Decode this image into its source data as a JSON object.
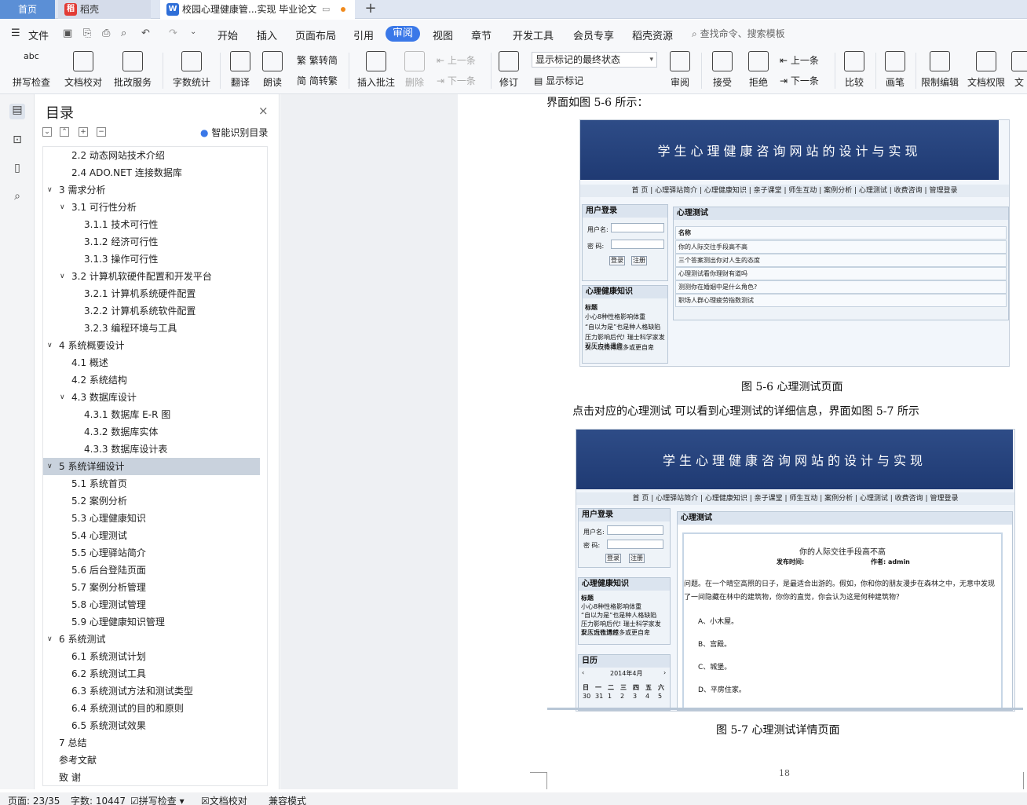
{
  "tabs": {
    "home": "首页",
    "daoke": "稻壳",
    "doc": "校园心理健康管...实现 毕业论文"
  },
  "menu": {
    "file": "文件",
    "items": [
      "开始",
      "插入",
      "页面布局",
      "引用",
      "审阅",
      "视图",
      "章节",
      "开发工具",
      "会员专享",
      "稻壳资源"
    ],
    "active": "审阅",
    "search": "查找命令、搜索模板"
  },
  "ribbon": {
    "spellcheck": "拼写检查",
    "doccheck": "文档校对",
    "batch": "批改服务",
    "wordcount": "字数统计",
    "translate": "翻译",
    "read": "朗读",
    "trad": "繁转简",
    "simp": "简转繁",
    "insertcomment": "插入批注",
    "delete": "删除",
    "prev": "上一条",
    "next": "下一条",
    "revise": "修订",
    "showstate": "显示标记的最终状态",
    "showmark": "显示标记",
    "review": "审阅",
    "accept": "接受",
    "reject": "拒绝",
    "prev2": "上一条",
    "next2": "下一条",
    "compare": "比较",
    "pen": "画笔",
    "restrict": "限制编辑",
    "perm": "文档权限",
    "more": "文"
  },
  "toc": {
    "title": "目录",
    "smart": "智能识别目录",
    "items": [
      "2.2  动态网站技术介绍",
      "2.4 ADO.NET 连接数据库",
      "3  需求分析",
      "3.1  可行性分析",
      "3.1.1  技术可行性",
      "3.1.2  经济可行性",
      "3.1.3  操作可行性",
      "3.2  计算机软硬件配置和开发平台",
      "3.2.1 计算机系统硬件配置",
      "3.2.2 计算机系统软件配置",
      "3.2.3 编程环境与工具",
      "4 系统概要设计",
      "4.1  概述",
      "4.2  系统结构",
      "4.3  数据库设计",
      "4.3.1  数据库 E-R 图",
      "4.3.2  数据库实体",
      "4.3.3 数据库设计表",
      "5 系统详细设计",
      "5.1  系统首页",
      "5.2 案例分析",
      "5.3 心理健康知识",
      "5.4 心理测试",
      "5.5 心理驿站简介",
      "5.6 后台登陆页面",
      "5.7 案例分析管理",
      "5.8 心理测试管理",
      "5.9 心理健康知识管理",
      "6 系统测试",
      "6.1 系统测试计划",
      "6.2  系统测试工具",
      "6.3 系统测试方法和测试类型",
      "6.4 系统测试的目的和原则",
      "6.5 系统测试效果",
      "7  总结",
      "参考文献",
      "致    谢"
    ]
  },
  "doc": {
    "topline": "界面如图 5-6 所示：",
    "cap1": "图 5-6 心理测试页面",
    "para": "点击对应的心理测试  可以看到心理测试的详细信息，界面如图 5-7 所示",
    "cap2": "图 5-7 心理测试详情页面",
    "pagenum": "18"
  },
  "site": {
    "banner": "学生心理健康咨询网站的设计与实现",
    "nav": "首 页  |  心理驿站简介  |  心理健康知识  |  亲子课堂  |  师生互动  |  案例分析  |  心理测试  |  收费咨询  |  管理登录",
    "login": "用户登录",
    "user": "用户名:",
    "pwd": "密   码:",
    "btn_login": "登录",
    "btn_reg": "注册",
    "know": "心理健康知识",
    "know_head": "标题",
    "know_items": [
      "小心8种性格影响体重",
      "“自以为是”也是种人格缺陷",
      "压力影响后代! 瑞士科学家发现压力也遗传",
      "女人玩微博越多或更自卑"
    ],
    "test": "心理测试",
    "test_head": "名称",
    "test_items": [
      "你的人际交往手段高不高",
      "三个答案测出你对人生的态度",
      "心理测试看你理财有道吗",
      "测测你在婚姻中是什么角色?",
      "职场人群心理疲劳指数测试"
    ],
    "detail_title": "你的人际交往手段高不高",
    "detail_meta1": "发布时间:",
    "detail_meta2": "作者:  admin",
    "question": "问题。在一个晴空高照的日子，是最适合出游的。假如，你和你的朋友漫步在森林之中，无意中发现了一间隐藏在林中的建筑物，你你的直觉，你会认为这是何种建筑物？",
    "options": [
      "A、小木屋。",
      "B、宫殿。",
      "C、城堡。",
      "D、平房住家。"
    ],
    "calendar": "日历",
    "month": "2014年4月",
    "weekdays": [
      "日",
      "一",
      "二",
      "三",
      "四",
      "五",
      "六"
    ],
    "days": [
      "30",
      "31",
      "1",
      "2",
      "3",
      "4",
      "5"
    ]
  },
  "status": {
    "page": "页面: 23/35",
    "words": "字数: 10447",
    "spell": "拼写检查",
    "doccheck": "文档校对",
    "compat": "兼容模式"
  }
}
